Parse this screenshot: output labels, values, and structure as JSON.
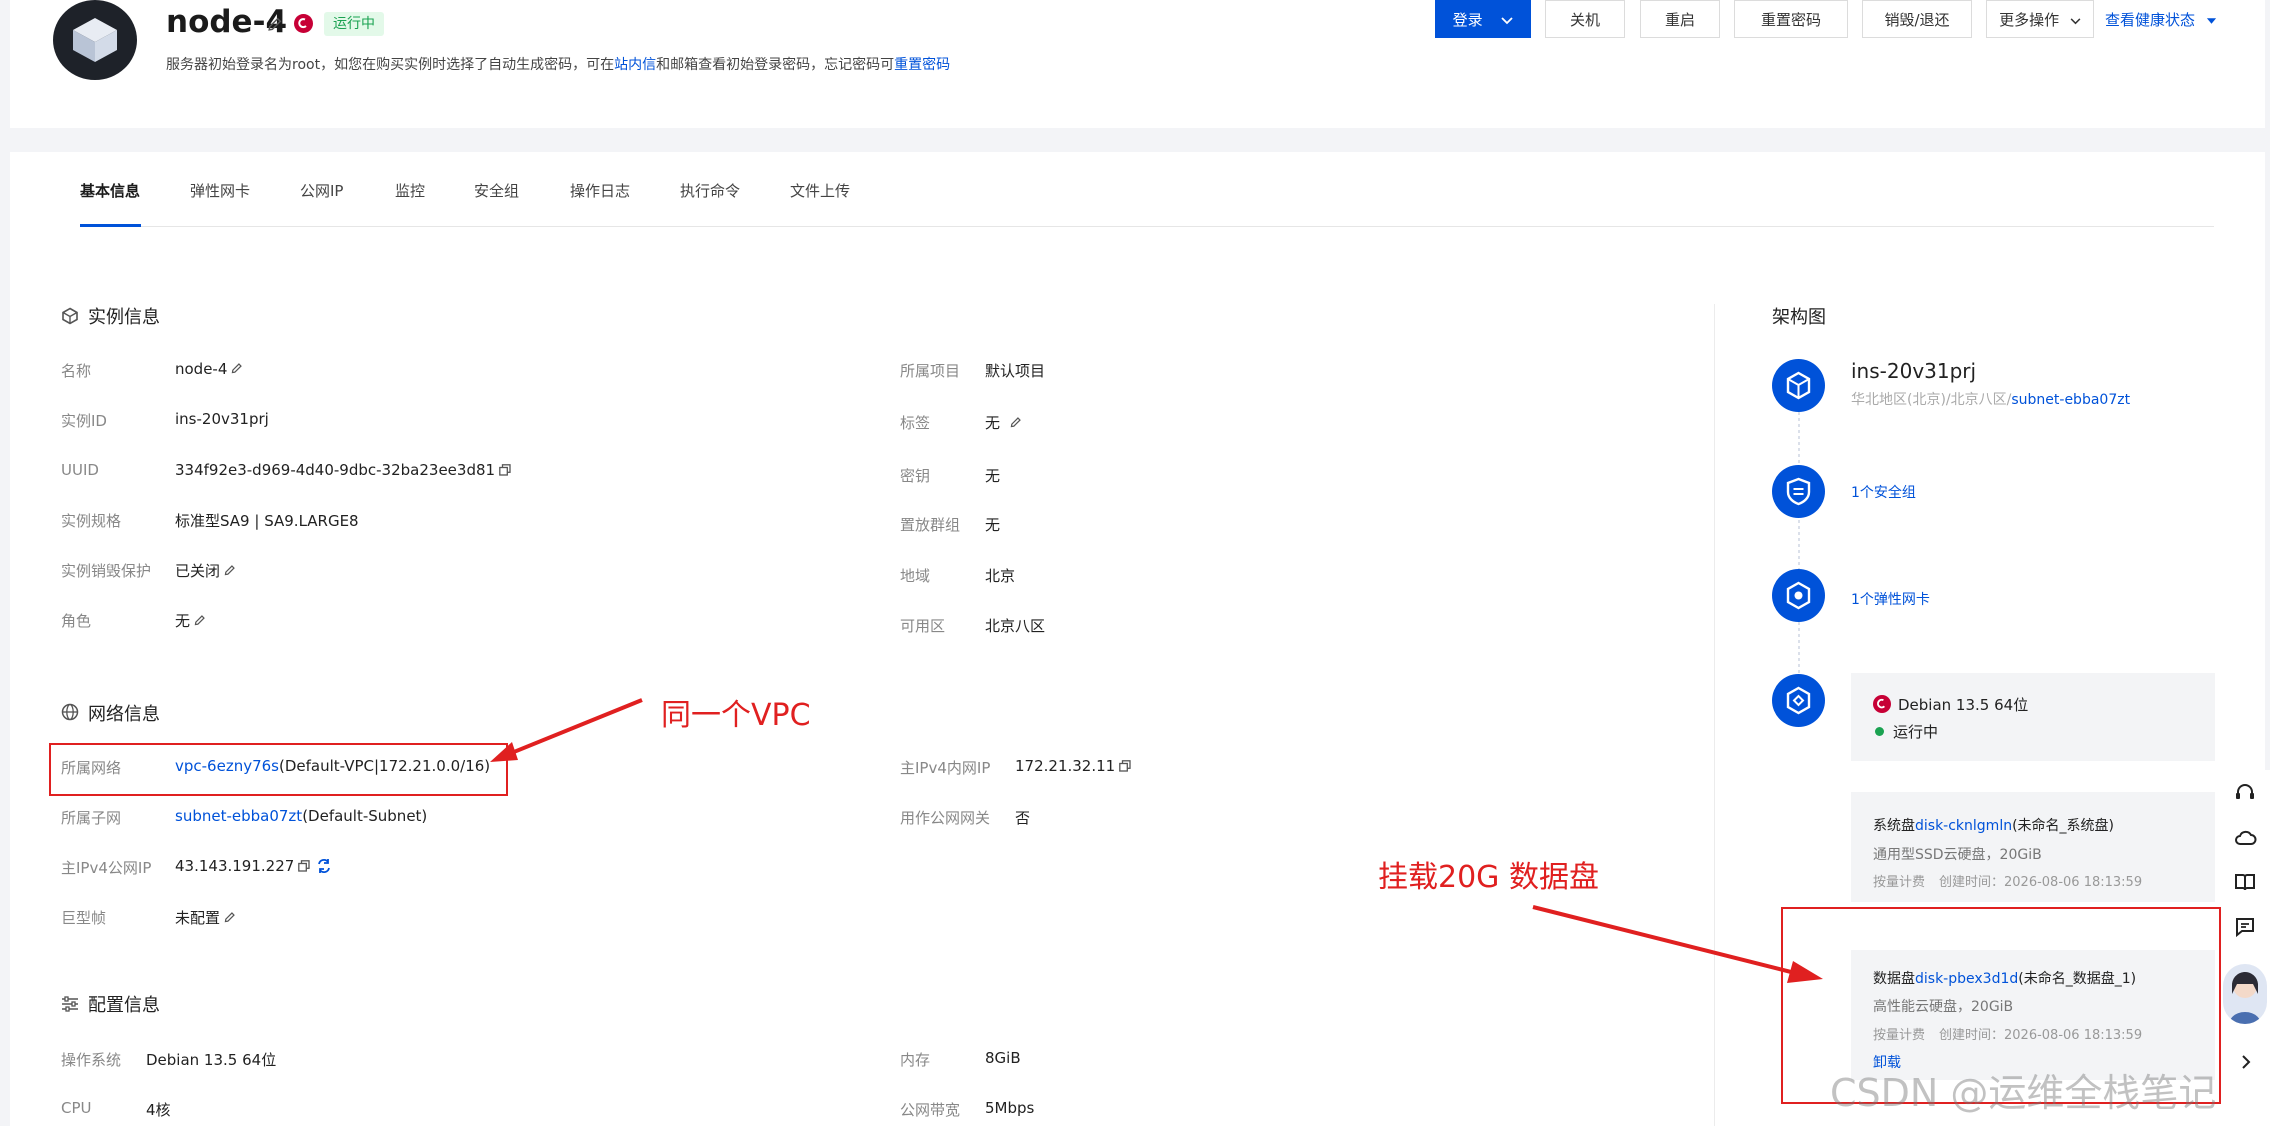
{
  "header": {
    "title": "node-4",
    "status": "运行中",
    "notice_prefix": "服务器初始登录名为root，如您在购买实例时选择了自动生成密码，可在",
    "notice_link1": "站内信",
    "notice_middle": "和邮箱查看初始登录密码，忘记密码可",
    "notice_link2": "重置密码",
    "buttons": {
      "login": "登录",
      "shutdown": "关机",
      "restart": "重启",
      "reset_password": "重置密码",
      "destroy": "销毁/退还",
      "more": "更多操作",
      "health": "查看健康状态"
    }
  },
  "tabs": [
    "基本信息",
    "弹性网卡",
    "公网IP",
    "监控",
    "安全组",
    "操作日志",
    "执行命令",
    "文件上传"
  ],
  "instance": {
    "title": "实例信息",
    "left": [
      {
        "label": "名称",
        "value": "node-4"
      },
      {
        "label": "实例ID",
        "value": "ins-20v31prj"
      },
      {
        "label": "UUID",
        "value": "334f92e3-d969-4d40-9dbc-32ba23ee3d81"
      },
      {
        "label": "实例规格",
        "value": "标准型SA9 | SA9.LARGE8"
      },
      {
        "label": "实例销毁保护",
        "value": "已关闭"
      },
      {
        "label": "角色",
        "value": "无"
      }
    ],
    "right": [
      {
        "label": "所属项目",
        "value": "默认项目"
      },
      {
        "label": "标签",
        "value": "无"
      },
      {
        "label": "密钥",
        "value": "无"
      },
      {
        "label": "置放群组",
        "value": "无"
      },
      {
        "label": "地域",
        "value": "北京"
      },
      {
        "label": "可用区",
        "value": "北京八区"
      }
    ]
  },
  "network": {
    "title": "网络信息",
    "vpc_label": "所属网络",
    "vpc_link": "vpc-6ezny76s",
    "vpc_suffix": "(Default-VPC|172.21.0.0/16)",
    "subnet_label": "所属子网",
    "subnet_link": "subnet-ebba07zt",
    "subnet_suffix": "(Default-Subnet)",
    "public_ip_label": "主IPv4公网IP",
    "public_ip": "43.143.191.227",
    "jumbo_label": "巨型帧",
    "jumbo_value": "未配置",
    "private_ip_label": "主IPv4内网IP",
    "private_ip": "172.21.32.11",
    "gateway_label": "用作公网网关",
    "gateway_value": "否"
  },
  "config": {
    "title": "配置信息",
    "os_label": "操作系统",
    "os_value": "Debian 13.5 64位",
    "cpu_label": "CPU",
    "cpu_value": "4核",
    "mem_label": "内存",
    "mem_value": "8GiB",
    "bw_label": "公网带宽",
    "bw_value": "5Mbps"
  },
  "arch": {
    "title": "架构图",
    "instance_id": "ins-20v31prj",
    "region_prefix": "华北地区(北京)/北京八区/",
    "region_link": "subnet-ebba07zt",
    "security_group": "1个安全组",
    "eni": "1个弹性网卡",
    "os": "Debian 13.5 64位",
    "running": "运行中",
    "system_disk_prefix": "系统盘",
    "system_disk_link": "disk-cknlgmln",
    "system_disk_suffix": "(未命名_系统盘)",
    "system_disk_type": "通用型SSD云硬盘，20GiB",
    "system_disk_billing": "按量计费",
    "system_disk_created": "创建时间：2026-08-06 18:13:59",
    "data_disk_prefix": "数据盘",
    "data_disk_link": "disk-pbex3d1d",
    "data_disk_suffix": "(未命名_数据盘_1)",
    "data_disk_type": "高性能云硬盘，20GiB",
    "data_disk_billing": "按量计费",
    "data_disk_created": "创建时间：2026-08-06 18:13:59",
    "unmount": "卸载"
  },
  "annotations": {
    "vpc_note": "同一个VPC",
    "disk_note": "挂载20G 数据盘"
  },
  "watermark": "CSDN @运维全栈笔记",
  "colors": {
    "primary": "#0052d9",
    "annotation": "#e02020",
    "running": "#1aa251"
  }
}
